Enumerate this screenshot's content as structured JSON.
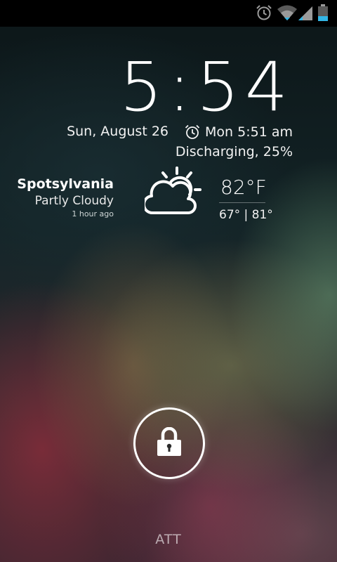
{
  "status_bar": {
    "icons": [
      "alarm-icon",
      "wifi-icon",
      "signal-icon",
      "battery-icon"
    ],
    "accent_color": "#33b5e5"
  },
  "lockscreen": {
    "time": "5:54",
    "date": "Sun, August 26",
    "next_alarm": "Mon 5:51 am",
    "battery_status": "Discharging, 25%"
  },
  "weather": {
    "location": "Spotsylvania",
    "condition": "Partly Cloudy",
    "updated": "1 hour ago",
    "temperature": "82°F",
    "low_high": "67° | 81°",
    "icon": "partly-cloudy-icon"
  },
  "unlock": {
    "icon": "padlock-icon"
  },
  "carrier": "ATT"
}
